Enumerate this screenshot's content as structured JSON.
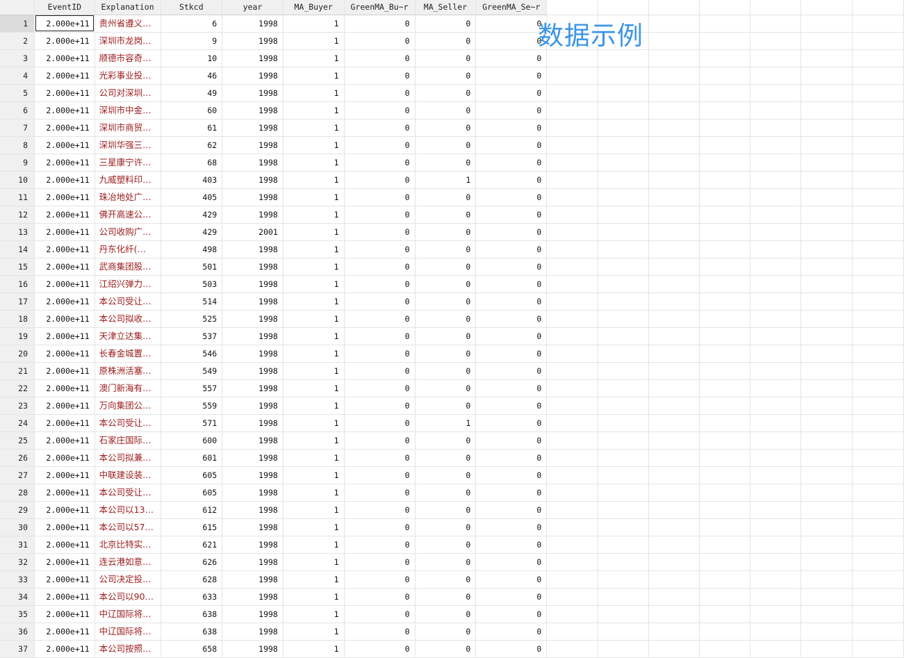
{
  "columns": [
    "EventID",
    "Explanation",
    "Stkcd",
    "year",
    "MA_Buyer",
    "GreenMA_Bu~r",
    "MA_Seller",
    "GreenMA_Se~r"
  ],
  "rows": [
    {
      "n": "1",
      "EventID": "2.000e+11",
      "Explanation": "贵州省遵义…",
      "Stkcd": "6",
      "year": "1998",
      "MA_Buyer": "1",
      "GreenMA_Buyer": "0",
      "MA_Seller": "0",
      "GreenMA_Seller": "0"
    },
    {
      "n": "2",
      "EventID": "2.000e+11",
      "Explanation": "深圳市龙岗…",
      "Stkcd": "9",
      "year": "1998",
      "MA_Buyer": "1",
      "GreenMA_Buyer": "0",
      "MA_Seller": "0",
      "GreenMA_Seller": "0"
    },
    {
      "n": "3",
      "EventID": "2.000e+11",
      "Explanation": "顺德市容奇…",
      "Stkcd": "10",
      "year": "1998",
      "MA_Buyer": "1",
      "GreenMA_Buyer": "0",
      "MA_Seller": "0",
      "GreenMA_Seller": "0"
    },
    {
      "n": "4",
      "EventID": "2.000e+11",
      "Explanation": "光彩事业投…",
      "Stkcd": "46",
      "year": "1998",
      "MA_Buyer": "1",
      "GreenMA_Buyer": "0",
      "MA_Seller": "0",
      "GreenMA_Seller": "0"
    },
    {
      "n": "5",
      "EventID": "2.000e+11",
      "Explanation": "公司对深圳…",
      "Stkcd": "49",
      "year": "1998",
      "MA_Buyer": "1",
      "GreenMA_Buyer": "0",
      "MA_Seller": "0",
      "GreenMA_Seller": "0"
    },
    {
      "n": "6",
      "EventID": "2.000e+11",
      "Explanation": "深圳市中金…",
      "Stkcd": "60",
      "year": "1998",
      "MA_Buyer": "1",
      "GreenMA_Buyer": "0",
      "MA_Seller": "0",
      "GreenMA_Seller": "0"
    },
    {
      "n": "7",
      "EventID": "2.000e+11",
      "Explanation": "深圳市商贸…",
      "Stkcd": "61",
      "year": "1998",
      "MA_Buyer": "1",
      "GreenMA_Buyer": "0",
      "MA_Seller": "0",
      "GreenMA_Seller": "0"
    },
    {
      "n": "8",
      "EventID": "2.000e+11",
      "Explanation": "深圳华强三…",
      "Stkcd": "62",
      "year": "1998",
      "MA_Buyer": "1",
      "GreenMA_Buyer": "0",
      "MA_Seller": "0",
      "GreenMA_Seller": "0"
    },
    {
      "n": "9",
      "EventID": "2.000e+11",
      "Explanation": "三星康宁许…",
      "Stkcd": "68",
      "year": "1998",
      "MA_Buyer": "1",
      "GreenMA_Buyer": "0",
      "MA_Seller": "0",
      "GreenMA_Seller": "0"
    },
    {
      "n": "10",
      "EventID": "2.000e+11",
      "Explanation": "九威塑料印…",
      "Stkcd": "403",
      "year": "1998",
      "MA_Buyer": "1",
      "GreenMA_Buyer": "0",
      "MA_Seller": "1",
      "GreenMA_Seller": "0"
    },
    {
      "n": "11",
      "EventID": "2.000e+11",
      "Explanation": "珠冶地处广…",
      "Stkcd": "405",
      "year": "1998",
      "MA_Buyer": "1",
      "GreenMA_Buyer": "0",
      "MA_Seller": "0",
      "GreenMA_Seller": "0"
    },
    {
      "n": "12",
      "EventID": "2.000e+11",
      "Explanation": "佛开高速公…",
      "Stkcd": "429",
      "year": "1998",
      "MA_Buyer": "1",
      "GreenMA_Buyer": "0",
      "MA_Seller": "0",
      "GreenMA_Seller": "0"
    },
    {
      "n": "13",
      "EventID": "2.000e+11",
      "Explanation": "公司收购广…",
      "Stkcd": "429",
      "year": "2001",
      "MA_Buyer": "1",
      "GreenMA_Buyer": "0",
      "MA_Seller": "0",
      "GreenMA_Seller": "0"
    },
    {
      "n": "14",
      "EventID": "2.000e+11",
      "Explanation": " 丹东化纤(…",
      "Stkcd": "498",
      "year": "1998",
      "MA_Buyer": "1",
      "GreenMA_Buyer": "0",
      "MA_Seller": "0",
      "GreenMA_Seller": "0"
    },
    {
      "n": "15",
      "EventID": "2.000e+11",
      "Explanation": "武商集团股…",
      "Stkcd": "501",
      "year": "1998",
      "MA_Buyer": "1",
      "GreenMA_Buyer": "0",
      "MA_Seller": "0",
      "GreenMA_Seller": "0"
    },
    {
      "n": "16",
      "EventID": "2.000e+11",
      "Explanation": "江绍兴弹力…",
      "Stkcd": "503",
      "year": "1998",
      "MA_Buyer": "1",
      "GreenMA_Buyer": "0",
      "MA_Seller": "0",
      "GreenMA_Seller": "0"
    },
    {
      "n": "17",
      "EventID": "2.000e+11",
      "Explanation": "本公司受让…",
      "Stkcd": "514",
      "year": "1998",
      "MA_Buyer": "1",
      "GreenMA_Buyer": "0",
      "MA_Seller": "0",
      "GreenMA_Seller": "0"
    },
    {
      "n": "18",
      "EventID": "2.000e+11",
      "Explanation": "本公司拟收…",
      "Stkcd": "525",
      "year": "1998",
      "MA_Buyer": "1",
      "GreenMA_Buyer": "0",
      "MA_Seller": "0",
      "GreenMA_Seller": "0"
    },
    {
      "n": "19",
      "EventID": "2.000e+11",
      "Explanation": "天津立达集…",
      "Stkcd": "537",
      "year": "1998",
      "MA_Buyer": "1",
      "GreenMA_Buyer": "0",
      "MA_Seller": "0",
      "GreenMA_Seller": "0"
    },
    {
      "n": "20",
      "EventID": "2.000e+11",
      "Explanation": "长春金城置…",
      "Stkcd": "546",
      "year": "1998",
      "MA_Buyer": "1",
      "GreenMA_Buyer": "0",
      "MA_Seller": "0",
      "GreenMA_Seller": "0"
    },
    {
      "n": "21",
      "EventID": "2.000e+11",
      "Explanation": "原株洲活塞…",
      "Stkcd": "549",
      "year": "1998",
      "MA_Buyer": "1",
      "GreenMA_Buyer": "0",
      "MA_Seller": "0",
      "GreenMA_Seller": "0"
    },
    {
      "n": "22",
      "EventID": "2.000e+11",
      "Explanation": "澳门新海有…",
      "Stkcd": "557",
      "year": "1998",
      "MA_Buyer": "1",
      "GreenMA_Buyer": "0",
      "MA_Seller": "0",
      "GreenMA_Seller": "0"
    },
    {
      "n": "23",
      "EventID": "2.000e+11",
      "Explanation": "万向集团公…",
      "Stkcd": "559",
      "year": "1998",
      "MA_Buyer": "1",
      "GreenMA_Buyer": "0",
      "MA_Seller": "0",
      "GreenMA_Seller": "0"
    },
    {
      "n": "24",
      "EventID": "2.000e+11",
      "Explanation": "本公司受让…",
      "Stkcd": "571",
      "year": "1998",
      "MA_Buyer": "1",
      "GreenMA_Buyer": "0",
      "MA_Seller": "1",
      "GreenMA_Seller": "0"
    },
    {
      "n": "25",
      "EventID": "2.000e+11",
      "Explanation": "石家庄国际…",
      "Stkcd": "600",
      "year": "1998",
      "MA_Buyer": "1",
      "GreenMA_Buyer": "0",
      "MA_Seller": "0",
      "GreenMA_Seller": "0"
    },
    {
      "n": "26",
      "EventID": "2.000e+11",
      "Explanation": "本公司拟兼…",
      "Stkcd": "601",
      "year": "1998",
      "MA_Buyer": "1",
      "GreenMA_Buyer": "0",
      "MA_Seller": "0",
      "GreenMA_Seller": "0"
    },
    {
      "n": "27",
      "EventID": "2.000e+11",
      "Explanation": "中联建设装…",
      "Stkcd": "605",
      "year": "1998",
      "MA_Buyer": "1",
      "GreenMA_Buyer": "0",
      "MA_Seller": "0",
      "GreenMA_Seller": "0"
    },
    {
      "n": "28",
      "EventID": "2.000e+11",
      "Explanation": "本公司受让…",
      "Stkcd": "605",
      "year": "1998",
      "MA_Buyer": "1",
      "GreenMA_Buyer": "0",
      "MA_Seller": "0",
      "GreenMA_Seller": "0"
    },
    {
      "n": "29",
      "EventID": "2.000e+11",
      "Explanation": "本公司以13…",
      "Stkcd": "612",
      "year": "1998",
      "MA_Buyer": "1",
      "GreenMA_Buyer": "0",
      "MA_Seller": "0",
      "GreenMA_Seller": "0"
    },
    {
      "n": "30",
      "EventID": "2.000e+11",
      "Explanation": "本公司以57…",
      "Stkcd": "615",
      "year": "1998",
      "MA_Buyer": "1",
      "GreenMA_Buyer": "0",
      "MA_Seller": "0",
      "GreenMA_Seller": "0"
    },
    {
      "n": "31",
      "EventID": "2.000e+11",
      "Explanation": "北京比特实…",
      "Stkcd": "621",
      "year": "1998",
      "MA_Buyer": "1",
      "GreenMA_Buyer": "0",
      "MA_Seller": "0",
      "GreenMA_Seller": "0"
    },
    {
      "n": "32",
      "EventID": "2.000e+11",
      "Explanation": "连云港如意…",
      "Stkcd": "626",
      "year": "1998",
      "MA_Buyer": "1",
      "GreenMA_Buyer": "0",
      "MA_Seller": "0",
      "GreenMA_Seller": "0"
    },
    {
      "n": "33",
      "EventID": "2.000e+11",
      "Explanation": "公司决定投…",
      "Stkcd": "628",
      "year": "1998",
      "MA_Buyer": "1",
      "GreenMA_Buyer": "0",
      "MA_Seller": "0",
      "GreenMA_Seller": "0"
    },
    {
      "n": "34",
      "EventID": "2.000e+11",
      "Explanation": "本公司以90…",
      "Stkcd": "633",
      "year": "1998",
      "MA_Buyer": "1",
      "GreenMA_Buyer": "0",
      "MA_Seller": "0",
      "GreenMA_Seller": "0"
    },
    {
      "n": "35",
      "EventID": "2.000e+11",
      "Explanation": "中辽国际将…",
      "Stkcd": "638",
      "year": "1998",
      "MA_Buyer": "1",
      "GreenMA_Buyer": "0",
      "MA_Seller": "0",
      "GreenMA_Seller": "0"
    },
    {
      "n": "36",
      "EventID": "2.000e+11",
      "Explanation": "中辽国际将…",
      "Stkcd": "638",
      "year": "1998",
      "MA_Buyer": "1",
      "GreenMA_Buyer": "0",
      "MA_Seller": "0",
      "GreenMA_Seller": "0"
    },
    {
      "n": "37",
      "EventID": "2.000e+11",
      "Explanation": "本公司按照…",
      "Stkcd": "658",
      "year": "1998",
      "MA_Buyer": "1",
      "GreenMA_Buyer": "0",
      "MA_Seller": "0",
      "GreenMA_Seller": "0"
    }
  ],
  "overlay_text": "数据示例",
  "colors": {
    "header_bg": "#f0f0f0",
    "grid_line": "#e4e4e4",
    "string_text": "#9c1b1b",
    "overlay_text": "#3b95e6",
    "selected_outline": "#222222"
  }
}
